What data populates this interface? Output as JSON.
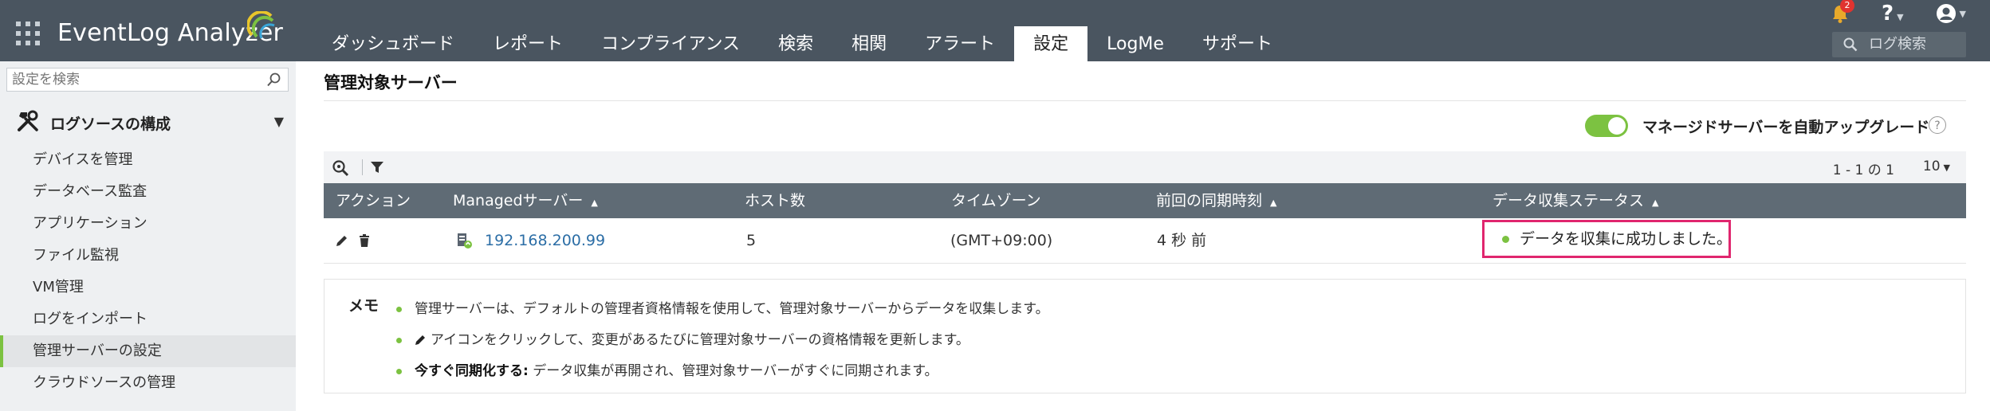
{
  "app": {
    "title": "EventLog Analyzer"
  },
  "nav": {
    "tabs": [
      {
        "label": "ダッシュボード",
        "active": false
      },
      {
        "label": "レポート",
        "active": false
      },
      {
        "label": "コンプライアンス",
        "active": false
      },
      {
        "label": "検索",
        "active": false
      },
      {
        "label": "相関",
        "active": false
      },
      {
        "label": "アラート",
        "active": false
      },
      {
        "label": "設定",
        "active": true
      },
      {
        "label": "LogMe",
        "active": false
      },
      {
        "label": "サポート",
        "active": false
      }
    ],
    "notification_count": "2",
    "help_label": "?",
    "log_search_label": "ログ検索"
  },
  "sidebar": {
    "search_placeholder": "設定を検索",
    "section_label": "ログソースの構成",
    "items": [
      {
        "label": "デバイスを管理",
        "active": false
      },
      {
        "label": "データベース監査",
        "active": false
      },
      {
        "label": "アプリケーション",
        "active": false
      },
      {
        "label": "ファイル監視",
        "active": false
      },
      {
        "label": "VM管理",
        "active": false
      },
      {
        "label": "ログをインポート",
        "active": false
      },
      {
        "label": "管理サーバーの設定",
        "active": true
      },
      {
        "label": "クラウドソースの管理",
        "active": false
      }
    ]
  },
  "main": {
    "page_title": "管理対象サーバー",
    "auto_upgrade_label": "マネージドサーバーを自動アップグレード",
    "auto_upgrade_enabled": true,
    "help_icon": "?",
    "pager_text": "1 - 1 の 1",
    "per_page": "10",
    "columns": [
      {
        "label": "アクション",
        "sortable": false
      },
      {
        "label": "Managedサーバー",
        "sortable": true
      },
      {
        "label": "ホスト数",
        "sortable": false
      },
      {
        "label": "タイムゾーン",
        "sortable": false
      },
      {
        "label": "前回の同期時刻",
        "sortable": true
      },
      {
        "label": "データ収集ステータス",
        "sortable": true
      }
    ],
    "rows": [
      {
        "server": "192.168.200.99",
        "hosts": "5",
        "timezone": "(GMT+09:00)",
        "last_sync": "4 秒 前",
        "status": "データを収集に成功しました。"
      }
    ],
    "status_color": "#7cc241",
    "highlight_color": "#e0266e",
    "memo": {
      "title": "メモ",
      "line1": "管理サーバーは、デフォルトの管理者資格情報を使用して、管理対象サーバーからデータを収集します。",
      "line2": "アイコンをクリックして、変更があるたびに管理対象サーバーの資格情報を更新します。",
      "line3_bold": "今すぐ同期化する:",
      "line3_rest": " データ収集が再開され、管理対象サーバーがすぐに同期されます。"
    }
  },
  "colors": {
    "topbar": "#4a5560",
    "accent": "#7cc241",
    "table_header": "#5f6b75"
  }
}
